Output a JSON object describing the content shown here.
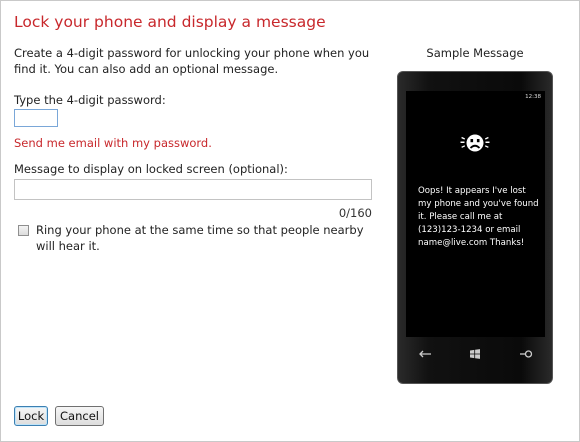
{
  "page": {
    "title": "Lock your phone and display a message",
    "description": "Create a 4-digit password for unlocking your phone when you find it. You can also add an optional message."
  },
  "password": {
    "label": "Type the 4-digit password:",
    "value": "",
    "email_link": "Send me email with my password."
  },
  "message": {
    "label": "Message to display on locked screen (optional):",
    "value": "",
    "counter": "0/160"
  },
  "ring": {
    "checked": false,
    "label": "Ring your phone at the same time so that people nearby will hear it."
  },
  "sample": {
    "label": "Sample Message",
    "clock": "12:38",
    "message": "Oops! It appears I've lost my phone and you've found it. Please call me at (123)123-1234 or email name@live.com Thanks!"
  },
  "buttons": {
    "lock": "Lock",
    "cancel": "Cancel"
  },
  "colors": {
    "accent": "#c8282c",
    "screen": "#000000"
  }
}
